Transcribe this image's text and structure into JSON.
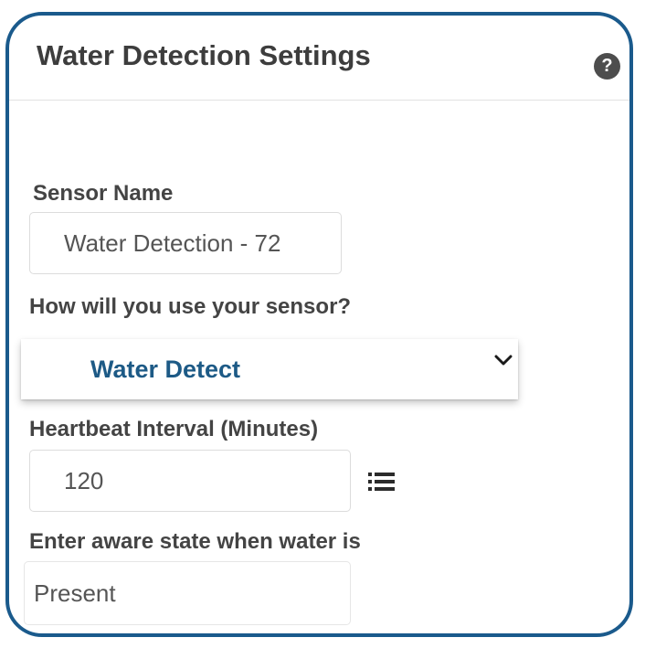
{
  "header": {
    "title": "Water Detection Settings",
    "help_icon_glyph": "?"
  },
  "sensor_name": {
    "label": "Sensor Name",
    "value": "Water Detection - 72"
  },
  "usage": {
    "label": "How will you use your sensor?",
    "selected": "Water Detect"
  },
  "heartbeat": {
    "label": "Heartbeat Interval (Minutes)",
    "value": "120"
  },
  "aware_state": {
    "label": "Enter aware state when water is",
    "value": "Present"
  },
  "colors": {
    "frame_border": "#1a5a8c",
    "select_text": "#1d5a86",
    "label_text": "#444444"
  },
  "icons": {
    "help": "help-icon",
    "dropdown": "chevron-down-icon",
    "options": "list-icon"
  }
}
